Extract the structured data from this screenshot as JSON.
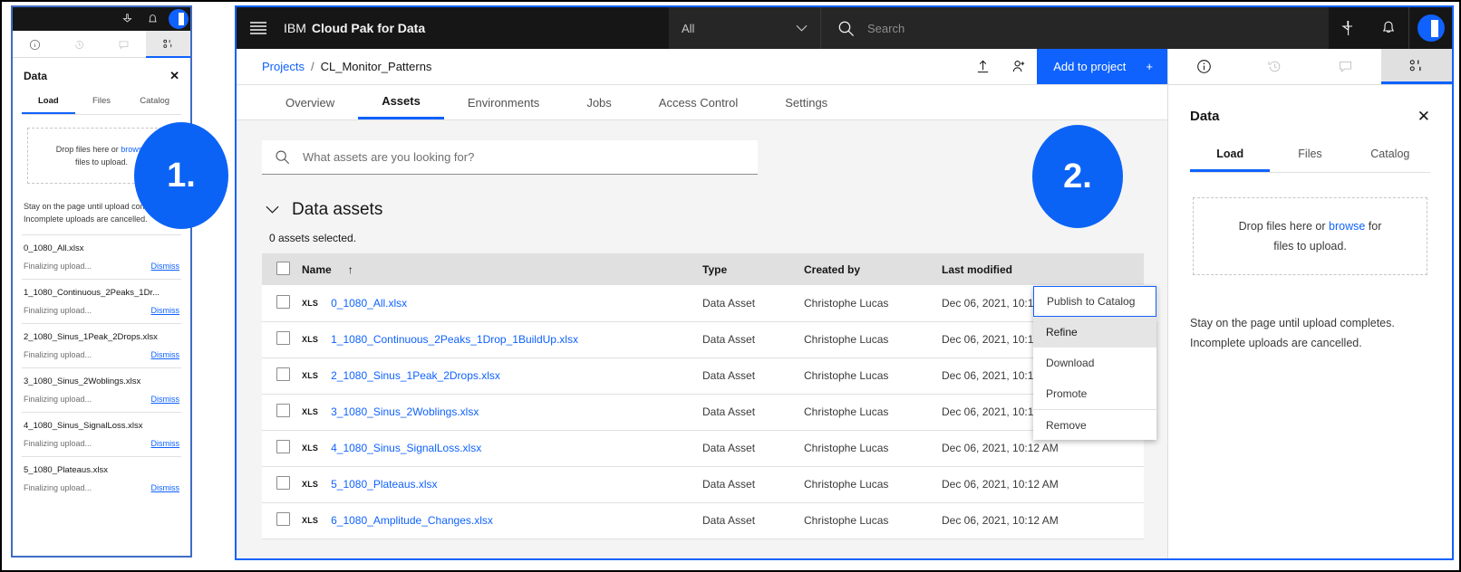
{
  "mini_panel": {
    "tabs": [
      {
        "icon": "info-icon",
        "name": "info"
      },
      {
        "icon": "history-icon",
        "name": "history"
      },
      {
        "icon": "comment-icon",
        "name": "comment"
      },
      {
        "icon": "data-icon",
        "name": "data"
      }
    ],
    "title": "Data",
    "close_label": "✕",
    "subtabs": [
      "Load",
      "Files",
      "Catalog"
    ],
    "drop_text_before": "Drop files here or ",
    "drop_link": "browse",
    "drop_text_after": " files to upload.",
    "note_line1": "Stay on the page until upload completes.",
    "note_line2": "Incomplete uploads are cancelled.",
    "files": [
      {
        "name": "0_1080_All.xlsx",
        "status": "Finalizing upload...",
        "action": "Dismiss"
      },
      {
        "name": "1_1080_Continuous_2Peaks_1Dr...",
        "status": "Finalizing upload...",
        "action": "Dismiss"
      },
      {
        "name": "2_1080_Sinus_1Peak_2Drops.xlsx",
        "status": "Finalizing upload...",
        "action": "Dismiss"
      },
      {
        "name": "3_1080_Sinus_2Woblings.xlsx",
        "status": "Finalizing upload...",
        "action": "Dismiss"
      },
      {
        "name": "4_1080_Sinus_SignalLoss.xlsx",
        "status": "Finalizing upload...",
        "action": "Dismiss"
      },
      {
        "name": "5_1080_Plateaus.xlsx",
        "status": "Finalizing upload...",
        "action": "Dismiss"
      }
    ]
  },
  "header": {
    "menu_icon": "hamburger-menu-icon",
    "brand_prefix": "IBM",
    "brand_name": "Cloud Pak for Data",
    "scope_value": "All",
    "search_placeholder": "Search",
    "icons": [
      "pin-icon",
      "notification-bell-icon"
    ],
    "avatar": "user-avatar"
  },
  "breadcrumb": {
    "root": "Projects",
    "separator": "/",
    "current": "CL_Monitor_Patterns",
    "upload_icon": "upload-icon",
    "add_user_icon": "add-collaborator-icon",
    "add_button": "Add to project",
    "add_button_plus": "+"
  },
  "tabs": [
    {
      "label": "Overview",
      "active": false
    },
    {
      "label": "Assets",
      "active": true
    },
    {
      "label": "Environments",
      "active": false
    },
    {
      "label": "Jobs",
      "active": false
    },
    {
      "label": "Access Control",
      "active": false
    },
    {
      "label": "Settings",
      "active": false
    }
  ],
  "search": {
    "placeholder": "What assets are you looking for?",
    "icon": "search-icon"
  },
  "section": {
    "chevron": "chevron-down-icon",
    "title": "Data assets",
    "selected_count": "0 assets selected."
  },
  "table": {
    "columns": [
      "Name",
      "Type",
      "Created by",
      "Last modified"
    ],
    "sort_indicator": "↑",
    "rows": [
      {
        "file_type": "XLS",
        "name": "0_1080_All.xlsx",
        "type": "Data Asset",
        "created_by": "Christophe Lucas",
        "last_modified": "Dec 06, 2021, 10:12 AM"
      },
      {
        "file_type": "XLS",
        "name": "1_1080_Continuous_2Peaks_1Drop_1BuildUp.xlsx",
        "type": "Data Asset",
        "created_by": "Christophe Lucas",
        "last_modified": "Dec 06, 2021, 10:12 AM"
      },
      {
        "file_type": "XLS",
        "name": "2_1080_Sinus_1Peak_2Drops.xlsx",
        "type": "Data Asset",
        "created_by": "Christophe Lucas",
        "last_modified": "Dec 06, 2021, 10:12 AM"
      },
      {
        "file_type": "XLS",
        "name": "3_1080_Sinus_2Woblings.xlsx",
        "type": "Data Asset",
        "created_by": "Christophe Lucas",
        "last_modified": "Dec 06, 2021, 10:12 AM"
      },
      {
        "file_type": "XLS",
        "name": "4_1080_Sinus_SignalLoss.xlsx",
        "type": "Data Asset",
        "created_by": "Christophe Lucas",
        "last_modified": "Dec 06, 2021, 10:12 AM"
      },
      {
        "file_type": "XLS",
        "name": "5_1080_Plateaus.xlsx",
        "type": "Data Asset",
        "created_by": "Christophe Lucas",
        "last_modified": "Dec 06, 2021, 10:12 AM"
      },
      {
        "file_type": "XLS",
        "name": "6_1080_Amplitude_Changes.xlsx",
        "type": "Data Asset",
        "created_by": "Christophe Lucas",
        "last_modified": "Dec 06, 2021, 10:12 AM"
      }
    ]
  },
  "overflow_menu": {
    "trigger_icon": "overflow-menu-icon",
    "items": [
      {
        "label": "Publish to Catalog",
        "state": "focused"
      },
      {
        "label": "Refine",
        "state": "hover"
      },
      {
        "label": "Download",
        "state": "normal"
      },
      {
        "label": "Promote",
        "state": "normal"
      },
      {
        "label": "Remove",
        "state": "separated"
      }
    ]
  },
  "right_panel": {
    "tabs": [
      {
        "icon": "info-icon",
        "active": false
      },
      {
        "icon": "history-icon",
        "active": false
      },
      {
        "icon": "comment-icon",
        "active": false
      },
      {
        "icon": "data-icon",
        "active": true
      }
    ],
    "title": "Data",
    "close_label": "✕",
    "subtabs": [
      "Load",
      "Files",
      "Catalog"
    ],
    "drop_text_before": "Drop files here or ",
    "drop_link": "browse",
    "drop_text_mid": " for",
    "drop_text_after": "files to upload.",
    "note_line1": "Stay on the page until upload completes.",
    "note_line2": "Incomplete uploads are cancelled."
  },
  "annotations": [
    {
      "label": "1.",
      "color": "#0b63f6"
    },
    {
      "label": "2.",
      "color": "#0b63f6"
    }
  ],
  "colors": {
    "brand_blue": "#0f62fe",
    "annotation_blue": "#0b63f6",
    "header_black": "#161616",
    "page_gray": "#f4f4f4"
  }
}
